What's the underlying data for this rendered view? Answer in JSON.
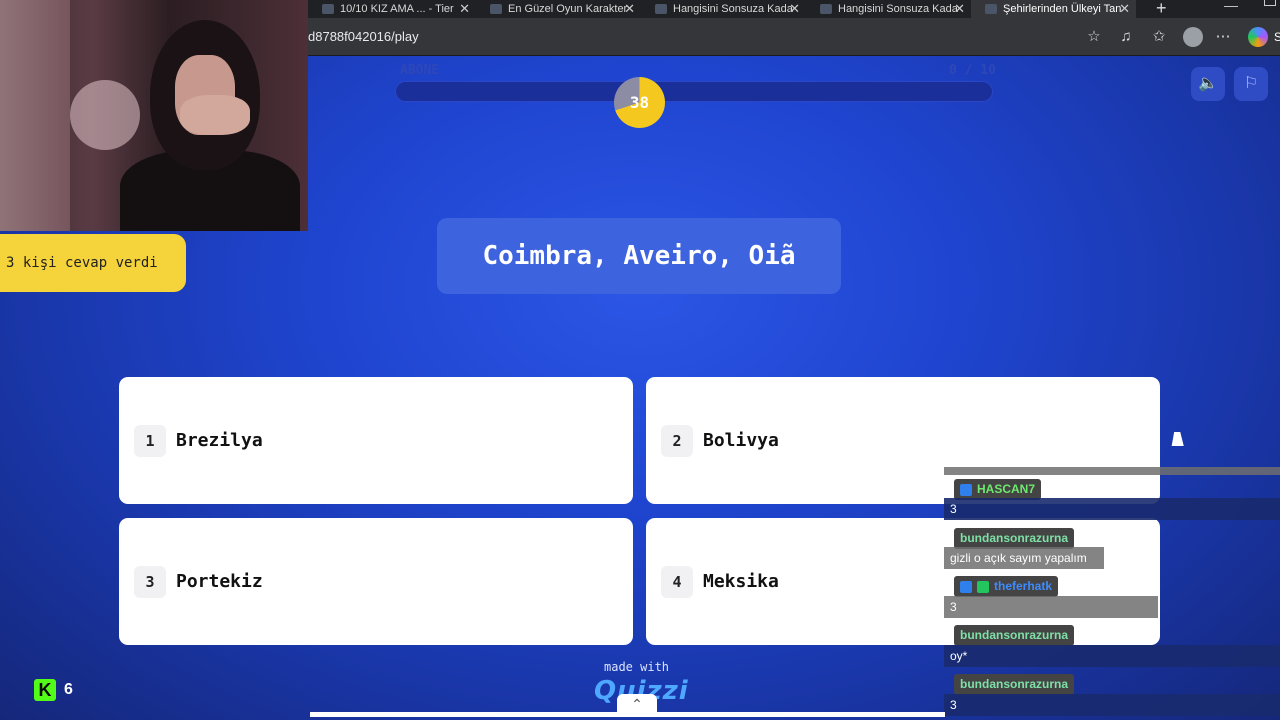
{
  "browser": {
    "tabs": [
      {
        "label": "10/10 KIZ AMA ... - Tier"
      },
      {
        "label": "En Güzel Oyun Karakter"
      },
      {
        "label": "Hangisini Sonsuza Kada"
      },
      {
        "label": "Hangisini Sonsuza Kada"
      },
      {
        "label": "Şehirlerinden Ülkeyi Tan"
      }
    ],
    "url": "d8788f042016/play",
    "copilot_label": "S"
  },
  "stream": {
    "answered_text": "3 kişi cevap verdi",
    "viewer_count": "6"
  },
  "quiz": {
    "progress_label": "ABONE",
    "progress_count": "0 / 10",
    "timer": "38",
    "question": "Coimbra, Aveiro, Oiã",
    "answers": [
      {
        "num": "1",
        "label": "Brezilya"
      },
      {
        "num": "2",
        "label": "Bolivya"
      },
      {
        "num": "3",
        "label": "Portekiz"
      },
      {
        "num": "4",
        "label": "Meksika"
      }
    ],
    "made_with": "made with",
    "brand": "Quizzi"
  },
  "chat": [
    {
      "user": "HASCAN7",
      "message": "3",
      "user_color": "#6ee86e"
    },
    {
      "user": "bundansonrazurna",
      "message": "gizli o açık sayım yapalım",
      "user_color": "#7ee0a6"
    },
    {
      "user": "theferhatk",
      "message": "3",
      "user_color": "#3d8bff"
    },
    {
      "user": "bundansonrazurna",
      "message": "oy*",
      "user_color": "#7ee0a6"
    },
    {
      "user": "bundansonrazurna",
      "message": "3",
      "user_color": "#7ee0a6"
    }
  ],
  "colors": {
    "accent_yellow": "#f5d33b",
    "background_blue": "#1f45d0",
    "kick_green": "#53fc18"
  }
}
